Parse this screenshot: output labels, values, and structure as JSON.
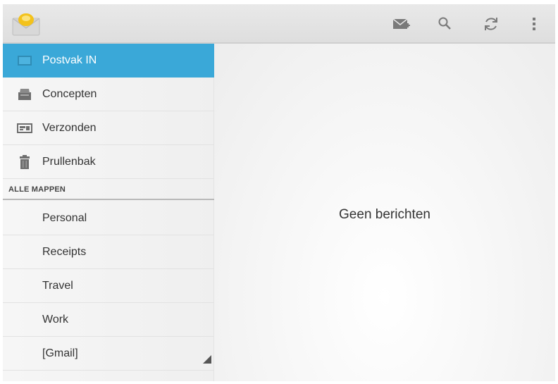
{
  "actionbar": {
    "app_icon": "gmail-envelope-icon",
    "actions": [
      {
        "name": "compose-icon",
        "label": "Nieuw bericht"
      },
      {
        "name": "search-icon",
        "label": "Zoeken"
      },
      {
        "name": "refresh-icon",
        "label": "Vernieuwen"
      },
      {
        "name": "overflow-menu-icon",
        "label": "Meer"
      }
    ]
  },
  "sidebar": {
    "mailboxes": [
      {
        "label": "Postvak IN",
        "icon": "inbox-icon",
        "selected": true
      },
      {
        "label": "Concepten",
        "icon": "drafts-icon",
        "selected": false
      },
      {
        "label": "Verzonden",
        "icon": "sent-icon",
        "selected": false
      },
      {
        "label": "Prullenbak",
        "icon": "trash-icon",
        "selected": false
      }
    ],
    "section_header": "ALLE MAPPEN",
    "folders": [
      {
        "label": "Personal"
      },
      {
        "label": "Receipts"
      },
      {
        "label": "Travel"
      },
      {
        "label": "Work"
      },
      {
        "label": "[Gmail]"
      }
    ]
  },
  "main": {
    "empty_message": "Geen berichten"
  },
  "colors": {
    "selected": "#3aa8d8",
    "actionbar": "#e2e2e2",
    "icon_gray": "#7a7a7a",
    "text": "#333333"
  }
}
